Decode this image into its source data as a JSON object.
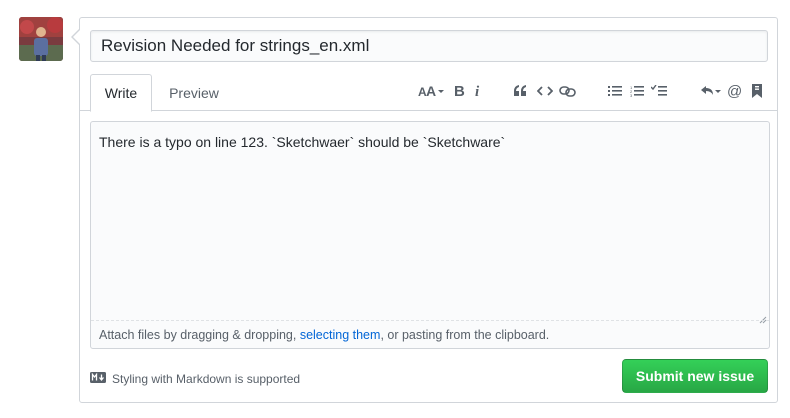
{
  "title_input": {
    "value": "Revision Needed for strings_en.xml",
    "placeholder": "Title"
  },
  "tabs": [
    {
      "label": "Write",
      "active": true
    },
    {
      "label": "Preview",
      "active": false
    }
  ],
  "toolbar": {
    "icons": [
      "text-size-icon",
      "bold-icon",
      "italic-icon",
      "quote-icon",
      "code-icon",
      "link-icon",
      "bullet-list-icon",
      "numbered-list-icon",
      "task-list-icon",
      "reply-icon",
      "mention-icon",
      "bookmark-icon"
    ]
  },
  "editor": {
    "body": "There is a typo on line 123. `Sketchwaer` should be `Sketchware`"
  },
  "attach_hint": {
    "before": "Attach files by dragging & dropping, ",
    "link": "selecting them",
    "after": ", or pasting from the clipboard."
  },
  "markdown_note": {
    "badge": "M↓",
    "text": "Styling with Markdown is supported"
  },
  "submit_label": "Submit new issue",
  "colors": {
    "accent_green": "#28a745",
    "link_blue": "#0366d6",
    "border": "#d1d5da"
  }
}
